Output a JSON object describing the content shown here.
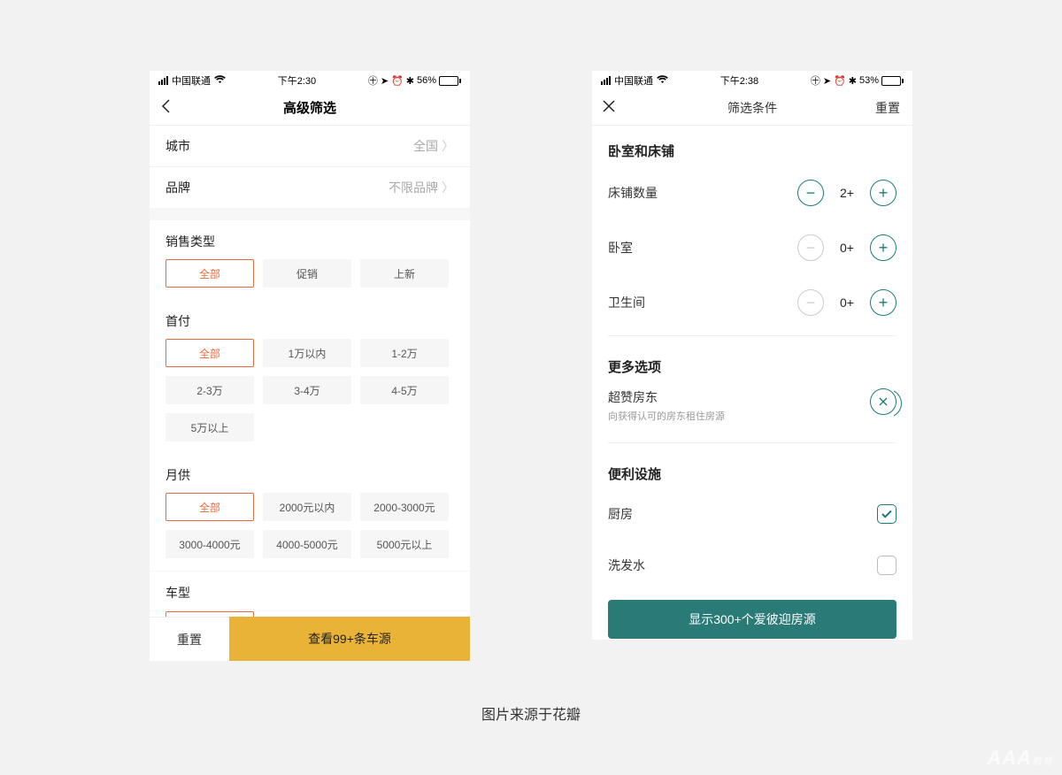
{
  "caption": "图片来源于花瓣",
  "watermark_main": "AAA",
  "watermark_sub": "教育",
  "phoneA": {
    "status": {
      "carrier": "中国联通",
      "time": "下午2:30",
      "battery_pct": "56%",
      "battery_fill": 56
    },
    "nav": {
      "title": "高级筛选"
    },
    "rows": {
      "city_label": "城市",
      "city_value": "全国",
      "brand_label": "品牌",
      "brand_value": "不限品牌"
    },
    "sections": {
      "sale_type": {
        "title": "销售类型",
        "opts": [
          "全部",
          "促销",
          "上新"
        ],
        "selected": 0
      },
      "downpayment": {
        "title": "首付",
        "opts": [
          "全部",
          "1万以内",
          "1-2万",
          "2-3万",
          "3-4万",
          "4-5万",
          "5万以上"
        ],
        "selected": 0
      },
      "monthly": {
        "title": "月供",
        "opts": [
          "全部",
          "2000元以内",
          "2000-3000元",
          "3000-4000元",
          "4000-5000元",
          "5000元以上"
        ],
        "selected": 0
      },
      "cartype": {
        "title": "车型"
      }
    },
    "bottom": {
      "reset": "重置",
      "submit": "查看99+条车源"
    }
  },
  "phoneB": {
    "status": {
      "carrier": "中国联通",
      "time": "下午2:38",
      "battery_pct": "53%",
      "battery_fill": 53
    },
    "nav": {
      "title": "筛选条件",
      "reset": "重置"
    },
    "section_bed": "卧室和床铺",
    "steppers": {
      "beds": {
        "label": "床铺数量",
        "value": "2+",
        "minus_disabled": false
      },
      "bedrooms": {
        "label": "卧室",
        "value": "0+",
        "minus_disabled": true
      },
      "bathrooms": {
        "label": "卫生间",
        "value": "0+",
        "minus_disabled": true
      }
    },
    "section_more": "更多选项",
    "superhost": {
      "title": "超赞房东",
      "subtitle": "向获得认可的房东租住房源"
    },
    "section_amenity": "便利设施",
    "amenities": {
      "kitchen": {
        "label": "厨房",
        "checked": true
      },
      "shampoo": {
        "label": "洗发水",
        "checked": false
      }
    },
    "submit": "显示300+个爱彼迎房源"
  }
}
